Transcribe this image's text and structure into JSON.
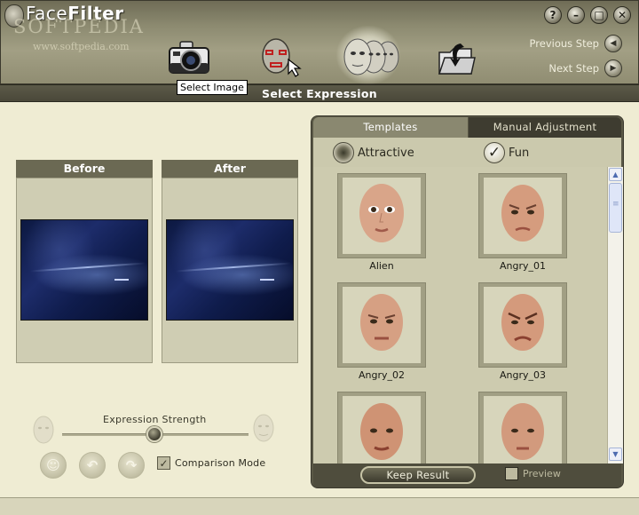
{
  "app": {
    "title_part1": "Face",
    "title_part2": "Filter",
    "watermark": "SOFTPEDIA",
    "watermark_url": "www.softpedia.com"
  },
  "toolbar": {
    "tooltip": "Select Image",
    "previous_label": "Previous Step",
    "next_label": "Next Step",
    "steps": [
      {
        "icon": "camera-icon"
      },
      {
        "icon": "face-select-icon"
      },
      {
        "icon": "expression-faces-icon"
      },
      {
        "icon": "save-folder-icon"
      }
    ],
    "window_buttons": [
      {
        "icon": "help-icon",
        "glyph": "?"
      },
      {
        "icon": "minimize-icon",
        "glyph": "–"
      },
      {
        "icon": "maximize-icon",
        "glyph": "□"
      },
      {
        "icon": "close-icon",
        "glyph": "✕"
      }
    ]
  },
  "step_title": "Select Expression",
  "preview": {
    "before_label": "Before",
    "after_label": "After",
    "strength_label": "Expression Strength",
    "strength_value": 0.5,
    "comparison_label": "Comparison Mode",
    "comparison_checked": true,
    "check_glyph": "✓"
  },
  "templates_panel": {
    "tabs": [
      {
        "label": "Templates",
        "active": true
      },
      {
        "label": "Manual Adjustment",
        "active": false
      }
    ],
    "categories": [
      {
        "label": "Attractive",
        "selected": false
      },
      {
        "label": "Fun",
        "selected": true
      }
    ],
    "templates": [
      {
        "label": "Alien"
      },
      {
        "label": "Angry_01"
      },
      {
        "label": "Angry_02"
      },
      {
        "label": "Angry_03"
      },
      {
        "label": ""
      },
      {
        "label": ""
      }
    ],
    "keep_label": "Keep Result",
    "preview_label": "Preview",
    "preview_checked": false
  },
  "colors": {
    "chrome": "#8c8a70",
    "panel": "#5a5846",
    "background": "#efecd3"
  }
}
